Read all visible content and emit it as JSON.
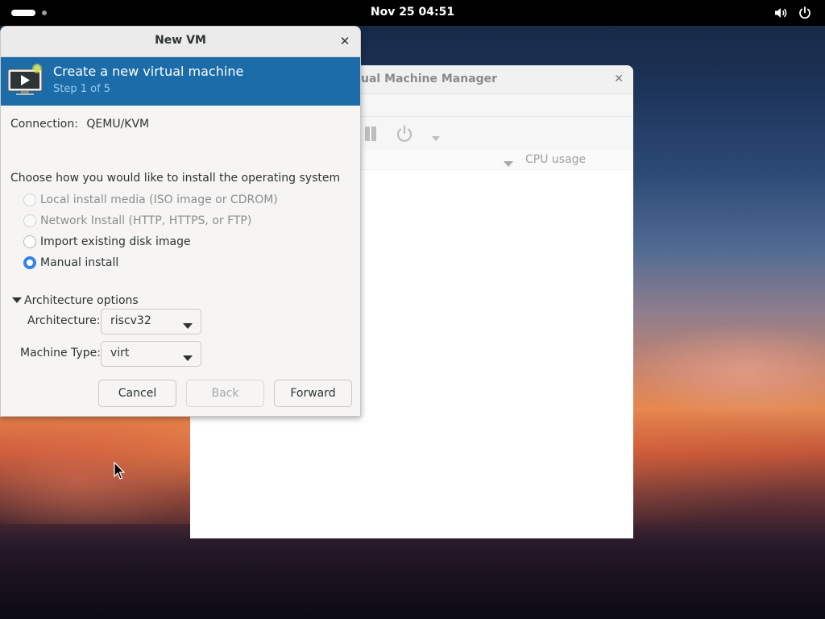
{
  "topbar": {
    "clock": "Nov 25  04:51",
    "icons": [
      "activities-indicator",
      "volume-icon",
      "power-icon"
    ]
  },
  "vmm_window": {
    "title": "ual Machine Manager",
    "column_cpu": "CPU usage"
  },
  "dialog": {
    "title": "New VM",
    "banner": {
      "title": "Create a new virtual machine",
      "step": "Step 1 of 5"
    },
    "connection": {
      "label": "Connection:",
      "value": "QEMU/KVM"
    },
    "install_prompt": "Choose how you would like to install the operating system",
    "install_options": [
      {
        "label": "Local install media (ISO image or CDROM)",
        "enabled": false,
        "selected": false
      },
      {
        "label": "Network Install (HTTP, HTTPS, or FTP)",
        "enabled": false,
        "selected": false
      },
      {
        "label": "Import existing disk image",
        "enabled": true,
        "selected": false
      },
      {
        "label": "Manual install",
        "enabled": true,
        "selected": true
      }
    ],
    "arch_expander": "Architecture options",
    "architecture": {
      "label": "Architecture:",
      "value": "riscv32"
    },
    "machine_type": {
      "label": "Machine Type:",
      "value": "virt"
    },
    "buttons": {
      "cancel": "Cancel",
      "back": "Back",
      "forward": "Forward"
    }
  },
  "colors": {
    "banner": "#1b6ca8",
    "accent": "#3584e4"
  }
}
